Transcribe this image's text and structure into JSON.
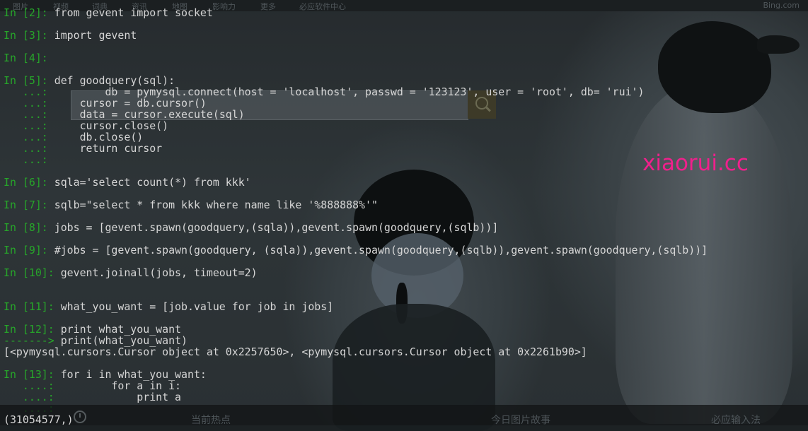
{
  "topnav": {
    "items": [
      "图片",
      "视频",
      "词典",
      "资讯",
      "地图",
      "影响力",
      "更多",
      "必应软件中心"
    ],
    "brand": "Bing.com"
  },
  "terminal": {
    "l1": {
      "prompt": "In [2]: ",
      "code": "from gevent import socket"
    },
    "l2": {
      "prompt": "In [3]: ",
      "code": "import gevent"
    },
    "l3": {
      "prompt": "In [4]: ",
      "code": ""
    },
    "l4": {
      "prompt": "In [5]: ",
      "code": "def goodquery(sql):"
    },
    "l5": {
      "prompt": "   ...: ",
      "code": "        db = pymysql.connect(host = 'localhost', passwd = '123123', user = 'root', db= 'rui')"
    },
    "l6": {
      "prompt": "   ...: ",
      "code": "    cursor = db.cursor()"
    },
    "l7": {
      "prompt": "   ...: ",
      "code": "    data = cursor.execute(sql)"
    },
    "l8": {
      "prompt": "   ...: ",
      "code": "    cursor.close()"
    },
    "l9": {
      "prompt": "   ...: ",
      "code": "    db.close()"
    },
    "l10": {
      "prompt": "   ...: ",
      "code": "    return cursor"
    },
    "l11": {
      "prompt": "   ...: ",
      "code": ""
    },
    "l12": {
      "prompt": "In [6]: ",
      "code": "sqla='select count(*) from kkk'"
    },
    "l13": {
      "prompt": "In [7]: ",
      "code": "sqlb=\"select * from kkk where name like '%888888%'\""
    },
    "l14": {
      "prompt": "In [8]: ",
      "code": "jobs = [gevent.spawn(goodquery,(sqla)),gevent.spawn(goodquery,(sqlb))]"
    },
    "l15": {
      "prompt": "In [9]: ",
      "code": "#jobs = [gevent.spawn(goodquery, (sqla)),gevent.spawn(goodquery,(sqlb)),gevent.spawn(goodquery,(sqlb))]"
    },
    "l16": {
      "prompt": "In [10]: ",
      "code": "gevent.joinall(jobs, timeout=2)"
    },
    "l17": {
      "prompt": "In [11]: ",
      "code": "what_you_want = [job.value for job in jobs]"
    },
    "l18": {
      "prompt": "In [12]: ",
      "code": "print what_you_want"
    },
    "l19": {
      "prompt": "-------> ",
      "code": "print(what_you_want)"
    },
    "l20": {
      "prompt": "",
      "code": "[<pymysql.cursors.Cursor object at 0x2257650>, <pymysql.cursors.Cursor object at 0x2261b90>]"
    },
    "l21": {
      "prompt": "In [13]: ",
      "code": "for i in what_you_want:"
    },
    "l22": {
      "prompt": "   ....: ",
      "code": "        for a in i:"
    },
    "l23": {
      "prompt": "   ....: ",
      "code": "            print a"
    },
    "l24": {
      "prompt": "   ....: ",
      "code": ""
    },
    "l25": {
      "prompt": "",
      "code": "(31054577,)"
    }
  },
  "watermark": "xiaorui.cc",
  "bottombar": {
    "items": [
      "当前热点",
      "今日图片故事",
      "必应输入法"
    ]
  },
  "colors": {
    "prompt_green": "#27a52a",
    "code_text": "#d6d6d6",
    "watermark_pink": "#f0208c"
  }
}
